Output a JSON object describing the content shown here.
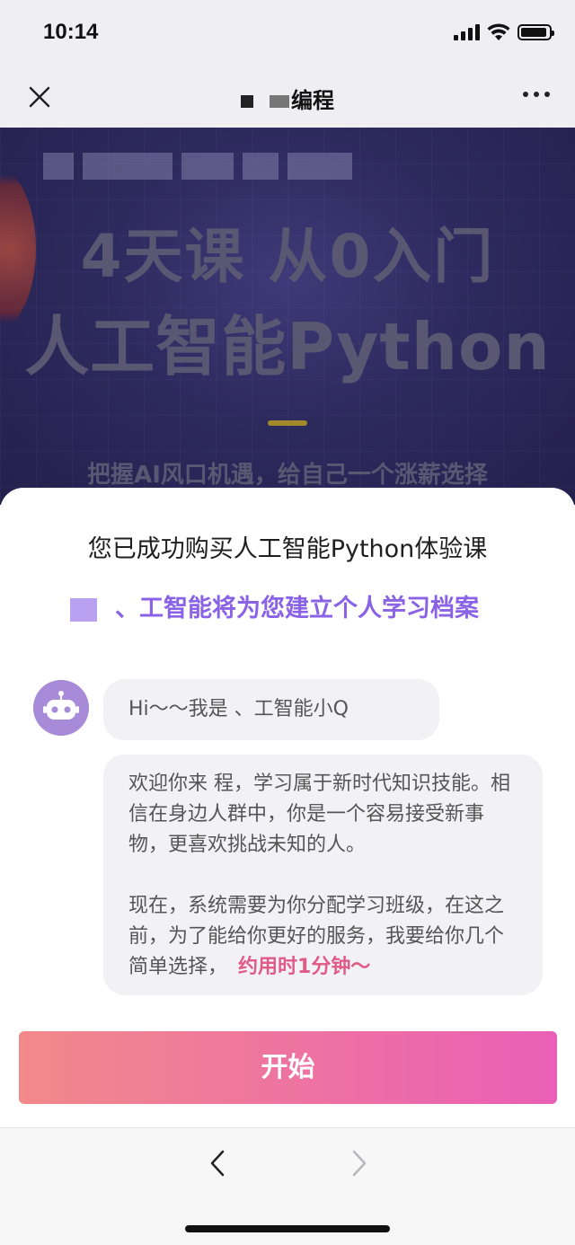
{
  "status_bar": {
    "time": "10:14"
  },
  "nav": {
    "title": "编程",
    "close_icon": "close-icon",
    "more_icon": "more-icon"
  },
  "banner": {
    "line1": "4天课 从0入门",
    "line2": "人工智能Python",
    "subtitle": "把握AI风口机遇，给自己一个涨薪选择"
  },
  "sheet": {
    "title": "您已成功购买人工智能Python体验课",
    "subtitle": "、工智能将为您建立个人学习档案",
    "accent_color": "#8a62e6"
  },
  "chat": {
    "bubble1": "Hi～～我是 、工智能小Q",
    "bubble2_para1": "欢迎你来 程，学习属于新时代知识技能。相信在身边人群中，你是一个容易接受新事物，更喜欢挑战未知的人。",
    "bubble2_para2": "现在，系统需要为你分配学习班级，在这之前，为了能给你更好的服务，我要给你几个简单选择，",
    "bubble2_highlight": "约用时1分钟～",
    "highlight_color": "#e05a85"
  },
  "start_button": {
    "label": "开始"
  },
  "bottom_nav": {
    "back_icon": "chevron-left-icon",
    "forward_icon": "chevron-right-icon"
  }
}
